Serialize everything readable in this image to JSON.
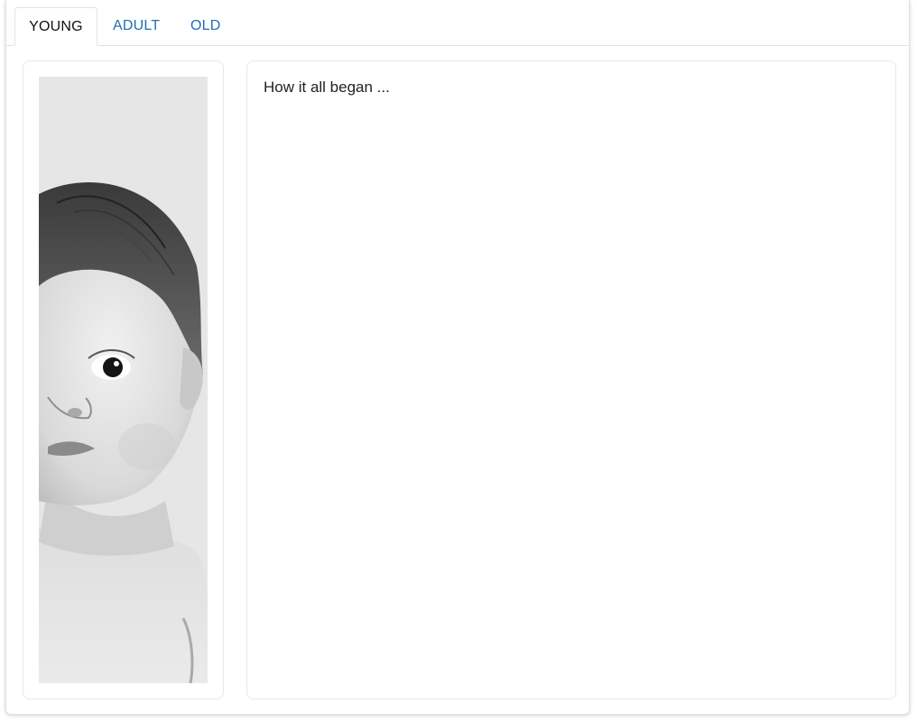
{
  "tabs": [
    {
      "label": "YOUNG",
      "active": true
    },
    {
      "label": "ADULT",
      "active": false
    },
    {
      "label": "OLD",
      "active": false
    }
  ],
  "content": {
    "image": {
      "subject": "pencil-sketch-baby-portrait"
    },
    "text": "How it all began ..."
  },
  "colors": {
    "tab_active_text": "#111111",
    "tab_inactive_text": "#1f6db6",
    "border": "#e3e3e3"
  }
}
